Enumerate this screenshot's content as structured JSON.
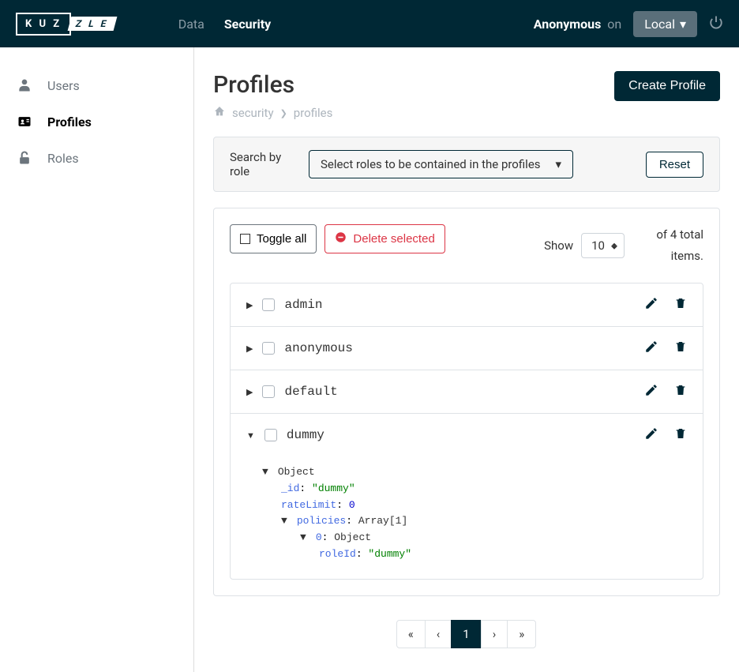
{
  "header": {
    "nav": {
      "data": "Data",
      "security": "Security"
    },
    "user": "Anonymous",
    "on": "on",
    "env": "Local"
  },
  "sidebar": {
    "users": "Users",
    "profiles": "Profiles",
    "roles": "Roles"
  },
  "page": {
    "title": "Profiles",
    "breadcrumb": {
      "home": "security",
      "current": "profiles"
    },
    "create_btn": "Create Profile"
  },
  "search": {
    "label": "Search by role",
    "selector": "Select roles to be contained in the profiles",
    "reset": "Reset"
  },
  "toolbar": {
    "toggle": "Toggle all",
    "delete": "Delete selected",
    "show": "Show",
    "count": "10",
    "total": "of 4 total items."
  },
  "items": {
    "0": "admin",
    "1": "anonymous",
    "2": "default",
    "3": "dummy"
  },
  "json": {
    "object": "Object",
    "id_key": "_id",
    "id_val": "\"dummy\"",
    "rate_key": "rateLimit",
    "rate_val": "0",
    "pol_key": "policies",
    "pol_val": "Array[1]",
    "idx_key": "0",
    "idx_val": "Object",
    "role_key": "roleId",
    "role_val": "\"dummy\""
  },
  "pagination": {
    "first": "«",
    "prev": "‹",
    "current": "1",
    "next": "›",
    "last": "»"
  }
}
